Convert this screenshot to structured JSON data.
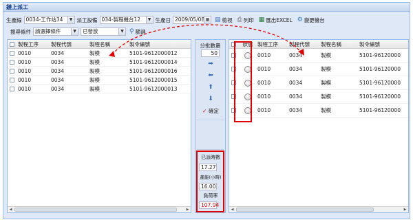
{
  "window": {
    "title": "鏈上派工"
  },
  "toolbar1": {
    "line_label": "生產線",
    "line_value": "0034-工作站34",
    "device_label": "派工設備",
    "device_value": "034-製程機台12",
    "date_label": "生產日",
    "date_value": "2009/05/08",
    "search_label": "檢視",
    "print_label": "列印",
    "export_label": "匯出EXCEL",
    "change_label": "變更機台"
  },
  "toolbar2": {
    "filter_label": "搜尋條件",
    "filter_value": "請選擇條件",
    "status_value": "已發放",
    "query_label": "篩選"
  },
  "left_grid": {
    "columns": [
      "製程工序",
      "製程代號",
      "製程名稱",
      "製令編號"
    ],
    "rows": [
      [
        "0010",
        "0034",
        "製模",
        "5101-9612000012"
      ],
      [
        "0010",
        "0034",
        "製模",
        "5101-9612000014"
      ],
      [
        "0010",
        "0034",
        "製模",
        "5101-9612000016"
      ],
      [
        "0010",
        "0034",
        "製模",
        "5101-9612000015"
      ],
      [
        "0010",
        "0034",
        "製模",
        "5101-9612000013"
      ]
    ]
  },
  "middle": {
    "batch_label": "分批數量",
    "batch_value": "50",
    "confirm_label": "確定",
    "dispatched_label": "已派時數",
    "dispatched_value": "17.27",
    "capacity_label": "產能(小時)",
    "capacity_value": "16.00",
    "load_label": "負荷率",
    "load_value": "107.94"
  },
  "right_grid": {
    "columns": [
      "狀態",
      "製程工序",
      "製程代號",
      "製程名稱",
      "製令編號"
    ],
    "rows": [
      [
        "",
        "0010",
        "0034",
        "製模",
        "5101-96120000"
      ],
      [
        "",
        "0010",
        "0034",
        "製模",
        "5101-96120000"
      ],
      [
        "",
        "0010",
        "0034",
        "製模",
        "5101-96120000"
      ],
      [
        "",
        "0010",
        "0034",
        "製模",
        "5101-96120000"
      ],
      [
        "",
        "0010",
        "0034",
        "製模",
        "5101-96120000"
      ]
    ]
  },
  "colors": {
    "highlight": "#e00000",
    "header": "#15428b",
    "load_rate": "#e00000"
  }
}
